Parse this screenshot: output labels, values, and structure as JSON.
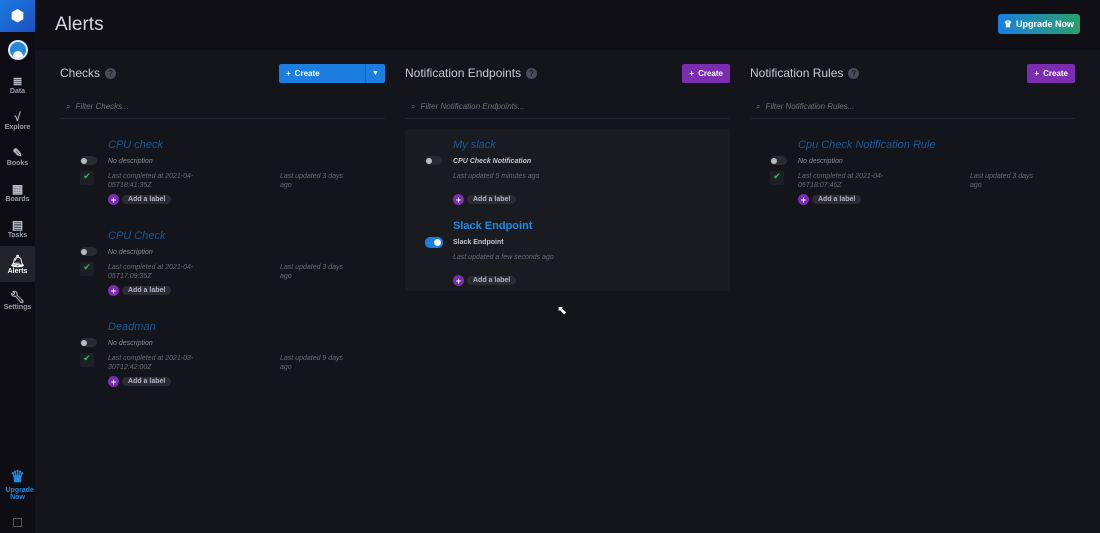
{
  "sidebar": {
    "items": [
      {
        "label": "Data",
        "icon": "database-icon",
        "glyph": "≣"
      },
      {
        "label": "Explore",
        "icon": "explore-icon",
        "glyph": "√"
      },
      {
        "label": "Books",
        "icon": "notebook-icon",
        "glyph": "✎"
      },
      {
        "label": "Boards",
        "icon": "dashboard-icon",
        "glyph": "▦"
      },
      {
        "label": "Tasks",
        "icon": "calendar-icon",
        "glyph": "▤"
      },
      {
        "label": "Alerts",
        "icon": "bell-icon",
        "glyph": "🔔︎"
      },
      {
        "label": "Settings",
        "icon": "wrench-icon",
        "glyph": "🔧︎"
      }
    ],
    "upgrade_label": "Upgrade Now"
  },
  "header": {
    "title": "Alerts",
    "upgrade_button": "Upgrade Now"
  },
  "checks": {
    "title": "Checks",
    "create": "Create",
    "placeholder": "Filter Checks...",
    "items": [
      {
        "name": "CPU check",
        "description": "No description",
        "completed": "Last completed at 2021-04-05T18:41:35Z",
        "updated": "Last updated 3 days ago",
        "label": "Add a label"
      },
      {
        "name": "CPU Check",
        "description": "No description",
        "completed": "Last completed at 2021-04-05T17:09:35Z",
        "updated": "Last updated 3 days ago",
        "label": "Add a label"
      },
      {
        "name": "Deadman",
        "description": "No description",
        "completed": "Last completed at 2021-03-30T12:42:00Z",
        "updated": "Last updated 9 days ago",
        "label": "Add a label"
      }
    ]
  },
  "endpoints": {
    "title": "Notification Endpoints",
    "create": "Create",
    "placeholder": "Filter Notification Endpoints...",
    "items": [
      {
        "name": "My slack",
        "description": "CPU Check Notification",
        "updated": "Last updated 5 minutes ago",
        "label": "Add a label",
        "enabled": false
      },
      {
        "name": "Slack Endpoint",
        "description": "Slack Endpoint",
        "updated": "Last updated a few seconds ago",
        "label": "Add a label",
        "enabled": true
      }
    ]
  },
  "rules": {
    "title": "Notification Rules",
    "create": "Create",
    "placeholder": "Filter Notification Rules...",
    "items": [
      {
        "name": "Cpu Check Notification Rule",
        "description": "No description",
        "completed": "Last completed at 2021-04-05T18:07:46Z",
        "updated": "Last updated 3 days ago",
        "label": "Add a label"
      }
    ]
  },
  "colors": {
    "accent": "#1c7ee0",
    "purple": "#7b2db0"
  }
}
